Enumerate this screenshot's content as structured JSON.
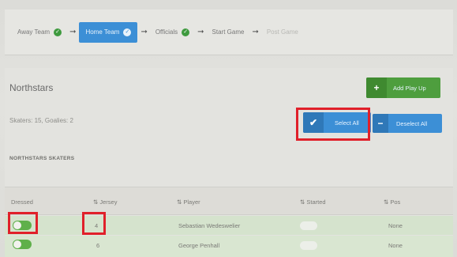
{
  "wizard": {
    "steps": [
      {
        "label": "Away Team",
        "state": "done"
      },
      {
        "label": "Home Team",
        "state": "active"
      },
      {
        "label": "Officials",
        "state": "done"
      },
      {
        "label": "Start Game",
        "state": "pending"
      },
      {
        "label": "Post Game",
        "state": "disabled"
      }
    ]
  },
  "panel": {
    "title": "Northstars",
    "counts": "Skaters: 15, Goalies: 2",
    "add_button": "Add Play Up",
    "select_all_button": "Select All",
    "deselect_all_button": "Deselect All",
    "skaters_heading": "NORTHSTARS SKATERS"
  },
  "table": {
    "columns": [
      "Dressed",
      "Jersey",
      "Player",
      "Started",
      "Pos"
    ],
    "rows": [
      {
        "jersey": "4",
        "player": "Sebastian Wedeswelier",
        "pos": "None",
        "dressed": true,
        "started": false
      },
      {
        "jersey": "6",
        "player": "George Penhall",
        "pos": "None",
        "dressed": true,
        "started": false
      }
    ]
  },
  "colors": {
    "primary_blue": "#3c8fd6",
    "success_green": "#4e9e3e",
    "highlight_red": "#e0202a"
  }
}
